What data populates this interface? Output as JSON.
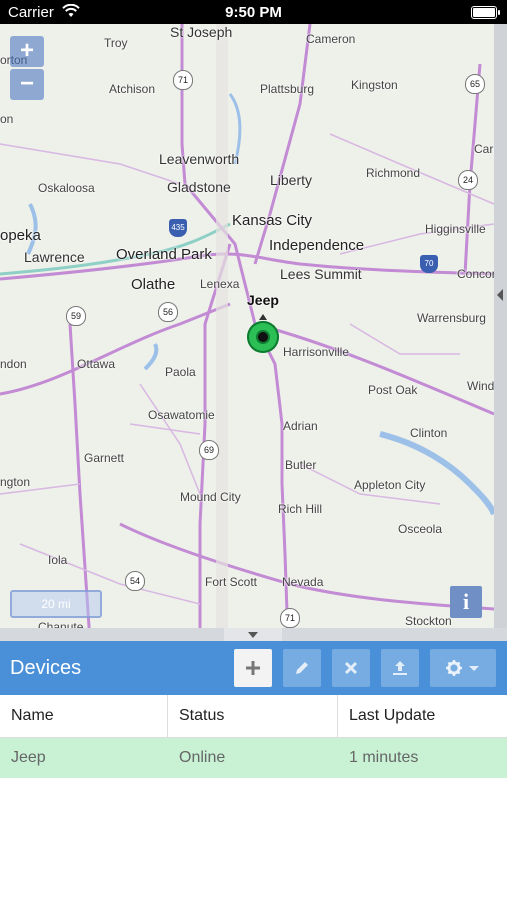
{
  "status_bar": {
    "carrier": "Carrier",
    "time": "9:50 PM"
  },
  "map": {
    "zoom_in": "+",
    "zoom_out": "−",
    "scale": "20 mi",
    "info": "i",
    "labels": [
      "St Joseph",
      "Troy",
      "Cameron",
      "Atchison",
      "Plattsburg",
      "Kingston",
      "Leavenworth",
      "Liberty",
      "Richmond",
      "Oskaloosa",
      "Gladstone",
      "Kansas City",
      "Independence",
      "Higginsville",
      "opeka",
      "Lawrence",
      "Overland Park",
      "Olathe",
      "Lenexa",
      "Lees Summit",
      "Concor",
      "Warrensburg",
      "Ottawa",
      "Paola",
      "Harrisonville",
      "Post Oak",
      "Wind",
      "Osawatomie",
      "Adrian",
      "Clinton",
      "Garnett",
      "Butler",
      "Appleton City",
      "ngton",
      "Mound City",
      "Rich Hill",
      "Osceola",
      "Iola",
      "Fort Scott",
      "Nevada",
      "Chanute",
      "Stockton",
      "orton",
      "Carr",
      "ndon",
      "on"
    ],
    "highway_shields": [
      "71",
      "65",
      "24",
      "435",
      "70",
      "59",
      "56",
      "69",
      "54",
      "71"
    ],
    "marker_label": "Jeep"
  },
  "devices": {
    "title": "Devices",
    "toolbar": {
      "add_icon": "plus-icon",
      "edit_icon": "pencil-icon",
      "remove_icon": "x-icon",
      "upload_icon": "upload-icon",
      "settings_icon": "gear-icon"
    },
    "columns": [
      "Name",
      "Status",
      "Last Update"
    ],
    "rows": [
      {
        "name": "Jeep",
        "status": "Online",
        "last_update": "1 minutes"
      }
    ]
  },
  "colors": {
    "header": "#4a90d9",
    "row_online": "#c9f2d5",
    "marker": "#2cbf56"
  }
}
